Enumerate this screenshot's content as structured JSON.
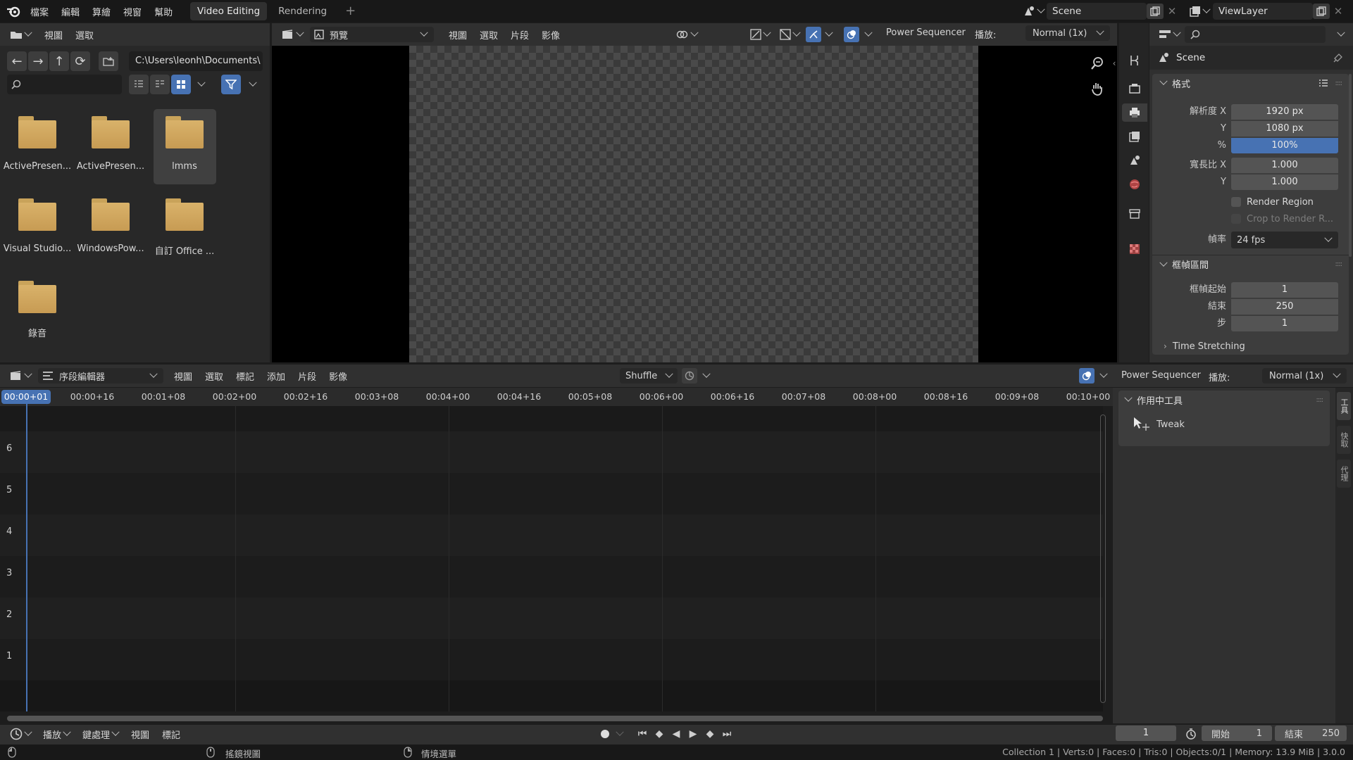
{
  "topbar": {
    "menus": [
      "檔案",
      "編輯",
      "算繪",
      "視窗",
      "幫助"
    ],
    "tabs": [
      "Video Editing",
      "Rendering"
    ],
    "add_tab": "+",
    "scene_name": "Scene",
    "viewlayer_name": "ViewLayer"
  },
  "file_browser": {
    "menus": [
      "視圖",
      "選取"
    ],
    "path": "C:\\Users\\leonh\\Documents\\",
    "items": [
      {
        "name": "ActivePresen..."
      },
      {
        "name": "ActivePresen..."
      },
      {
        "name": "lmms"
      },
      {
        "name": "Visual Studio..."
      },
      {
        "name": "WindowsPow..."
      },
      {
        "name": "自訂 Office ..."
      },
      {
        "name": "錄音"
      }
    ]
  },
  "preview": {
    "mode": "預覽",
    "menus": [
      "視圖",
      "選取",
      "片段",
      "影像"
    ],
    "power_sequencer": "Power Sequencer",
    "playback_label": "播放:",
    "playback_value": "Normal (1x)"
  },
  "properties": {
    "context_title": "Scene",
    "format_panel": "格式",
    "res_x_label": "解析度 X",
    "res_x": "1920 px",
    "res_y_label": "Y",
    "res_y": "1080 px",
    "pct_label": "%",
    "pct": "100%",
    "aspect_x_label": "寬長比 X",
    "aspect_x": "1.000",
    "aspect_y_label": "Y",
    "aspect_y": "1.000",
    "render_region": "Render Region",
    "crop": "Crop to Render R...",
    "fps_label": "幀率",
    "fps": "24 fps",
    "frame_range_panel": "框幀區間",
    "start_label": "框幀起始",
    "start": "1",
    "end_label": "結束",
    "end": "250",
    "step_label": "步",
    "step": "1",
    "time_stretching": "Time Stretching"
  },
  "sequencer": {
    "editor_type": "序段編輯器",
    "menus": [
      "視圖",
      "選取",
      "標記",
      "添加",
      "片段",
      "影像"
    ],
    "snap": "Shuffle",
    "power_sequencer": "Power Sequencer",
    "playback_label": "播放:",
    "playback_value": "Normal (1x)",
    "current_time": "00:00+01",
    "ticks": [
      "00:00+16",
      "00:01+08",
      "00:02+00",
      "00:02+16",
      "00:03+08",
      "00:04+00",
      "00:04+16",
      "00:05+08",
      "00:06+00",
      "00:06+16",
      "00:07+08",
      "00:08+00",
      "00:08+16",
      "00:09+08",
      "00:10+00"
    ],
    "channels": [
      "6",
      "5",
      "4",
      "3",
      "2",
      "1"
    ],
    "active_tool_panel": "作用中工具",
    "tool_name": "Tweak",
    "side_tabs": [
      "工具",
      "快取",
      "代理"
    ]
  },
  "timeline": {
    "menus": [
      "播放",
      "鍵處理",
      "視圖",
      "標記"
    ],
    "current_frame": "1",
    "start_label": "開始",
    "start_value": "1",
    "end_label": "結束",
    "end_value": "250"
  },
  "statusbar": {
    "hint1": "搖鏡視圖",
    "hint2": "情境選單",
    "stats": "Collection 1 | Verts:0 | Faces:0 | Tris:0 | Objects:0/1 | Memory: 13.9 MiB | 3.0.0"
  }
}
